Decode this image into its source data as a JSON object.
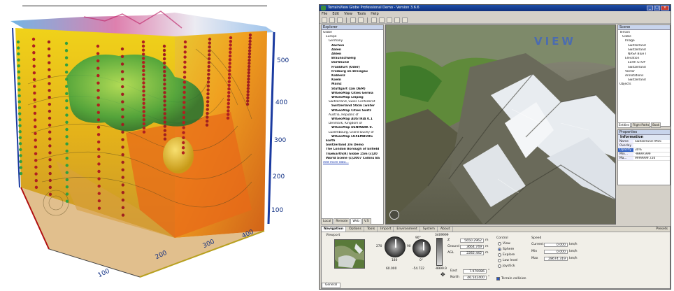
{
  "figure3d": {
    "right_axis_ticks": [
      "500",
      "400",
      "300",
      "200",
      "100"
    ],
    "bottom_axis_ticks": [
      "100",
      "200",
      "300",
      "400"
    ],
    "left_red_ticks": [
      "",
      "",
      "",
      "",
      "",
      "",
      "",
      ""
    ]
  },
  "app": {
    "title": "TerrainView Globe Professional Demo - Version 3.6.6",
    "menu": [
      "File",
      "Edit",
      "View",
      "Tools",
      "Help"
    ],
    "explorer": {
      "header": "Explorer",
      "items": [
        {
          "text": "Globe",
          "indent": 0,
          "bold": false
        },
        {
          "text": "Europe",
          "indent": 1,
          "bold": false
        },
        {
          "text": "Germany",
          "indent": 2,
          "bold": false
        },
        {
          "text": "Aachen",
          "indent": 3,
          "bold": true
        },
        {
          "text": "Aalen",
          "indent": 3,
          "bold": true
        },
        {
          "text": "Ahlen",
          "indent": 3,
          "bold": true
        },
        {
          "text": "Braunschweig",
          "indent": 3,
          "bold": true
        },
        {
          "text": "Dortmund",
          "indent": 3,
          "bold": true
        },
        {
          "text": "Frankfurt (Oder)",
          "indent": 3,
          "bold": true
        },
        {
          "text": "Freiburg im Breisgau",
          "indent": 3,
          "bold": true
        },
        {
          "text": "Koblenz",
          "indent": 3,
          "bold": true
        },
        {
          "text": "Koeln",
          "indent": 3,
          "bold": true
        },
        {
          "text": "Mainz",
          "indent": 3,
          "bold": true
        },
        {
          "text": "Stuttgart (1m DEM)",
          "indent": 3,
          "bold": true
        },
        {
          "text": "WIGeoMap Cities Germa",
          "indent": 3,
          "bold": true
        },
        {
          "text": "WIGeoMap Leipzig",
          "indent": 3,
          "bold": true
        },
        {
          "text": "Switzerland, Swiss Confederat",
          "indent": 2,
          "bold": false
        },
        {
          "text": "Switzerland 50cm (water",
          "indent": 3,
          "bold": true
        },
        {
          "text": "WIGeoMap Cities Switz",
          "indent": 3,
          "bold": true
        },
        {
          "text": "Austria, Republic of",
          "indent": 2,
          "bold": false
        },
        {
          "text": "WIGeoMap AUSTRIA 0.1",
          "indent": 3,
          "bold": true
        },
        {
          "text": "Denmark, Kingdom of",
          "indent": 2,
          "bold": false
        },
        {
          "text": "WIGeoMap DENMARK 0.",
          "indent": 3,
          "bold": true
        },
        {
          "text": "Luxembourg, Grand Duchy of",
          "indent": 2,
          "bold": false
        },
        {
          "text": "WIGeoMap LUXEMBURG",
          "indent": 3,
          "bold": true
        },
        {
          "text": "Earth",
          "indent": 1,
          "bold": true
        },
        {
          "text": "Switzerland 2m Demo",
          "indent": 1,
          "bold": true
        },
        {
          "text": "The London Borough of Enfield",
          "indent": 1,
          "bold": true
        },
        {
          "text": "TrueEarth(R) Globe 15m (c)20",
          "indent": 1,
          "bold": true
        },
        {
          "text": "World Scene (c)2007 Collins Ba",
          "indent": 1,
          "bold": true
        },
        {
          "text": "Add more data...",
          "indent": 0,
          "bold": false,
          "link": true
        }
      ],
      "tabs": [
        "Local",
        "Remote",
        "Web",
        "V.S"
      ]
    },
    "logo": "VIEW",
    "scene": {
      "header": "Scene",
      "items": [
        {
          "text": "Terrain",
          "indent": 0
        },
        {
          "text": "Globe",
          "indent": 1
        },
        {
          "text": "Image",
          "indent": 2
        },
        {
          "text": "Switzerland",
          "indent": 3
        },
        {
          "text": "Switzerland",
          "indent": 3
        },
        {
          "text": "NASA Blue I",
          "indent": 3
        },
        {
          "text": "Elevation",
          "indent": 2
        },
        {
          "text": "Earth GTOP",
          "indent": 3
        },
        {
          "text": "Switzerland",
          "indent": 3
        },
        {
          "text": "Vector",
          "indent": 2
        },
        {
          "text": "Annotations",
          "indent": 2
        },
        {
          "text": "Switzerland",
          "indent": 3
        },
        {
          "text": "Objects",
          "indent": 0
        }
      ],
      "tabs": [
        "Entities",
        "Flight Paths",
        "Book"
      ]
    },
    "properties": {
      "header": "Properties",
      "section": "Information",
      "rows": [
        {
          "k": "Name",
          "v": "Switzerland PA05"
        },
        {
          "k": "Overlay",
          "v": ""
        },
        {
          "k": "Opacity",
          "v": "30%"
        },
        {
          "k": "Min...",
          "v": "-9999.999"
        },
        {
          "k": "Ma...",
          "v": "9999999.720"
        }
      ]
    },
    "bottom": {
      "tabs": [
        "Navigation",
        "Options",
        "Tools",
        "Import",
        "Environment",
        "System",
        "About"
      ],
      "presets": "Presets",
      "viewport_label": "Viewport",
      "control_label": "Control",
      "speed_label": "Speed",
      "coords": [
        {
          "k": "Z",
          "v": "5650.2962",
          "u": "m"
        },
        {
          "k": "Ground",
          "v": "3664.749",
          "u": "m"
        },
        {
          "k": "AGL",
          "v": "2282.442",
          "u": "m"
        }
      ],
      "position": [
        {
          "k": "East",
          "v": "7.970086",
          "u": "°"
        },
        {
          "k": "North",
          "v": "46.542400",
          "u": "°"
        }
      ],
      "dial_labels": [
        "270",
        "90",
        "180",
        "90°",
        "0°"
      ],
      "dial_values": [
        "60.000",
        "-54.722"
      ],
      "slider_labels": [
        "3409999",
        "-9999.9"
      ],
      "modes": [
        {
          "label": "View",
          "on": false
        },
        {
          "label": "Sphere",
          "on": true
        },
        {
          "label": "Explore",
          "on": false
        },
        {
          "label": "Low level",
          "on": false
        },
        {
          "label": "Joystick",
          "on": false
        }
      ],
      "terrain_collision": "Terrain collision",
      "speed": [
        {
          "k": "Current",
          "v": "0.000",
          "u": "km/h"
        },
        {
          "k": "Min",
          "v": "0.000",
          "u": "km/h"
        },
        {
          "k": "Max",
          "v": "28674.319",
          "u": "km/h"
        }
      ],
      "general_tab": "General"
    }
  }
}
